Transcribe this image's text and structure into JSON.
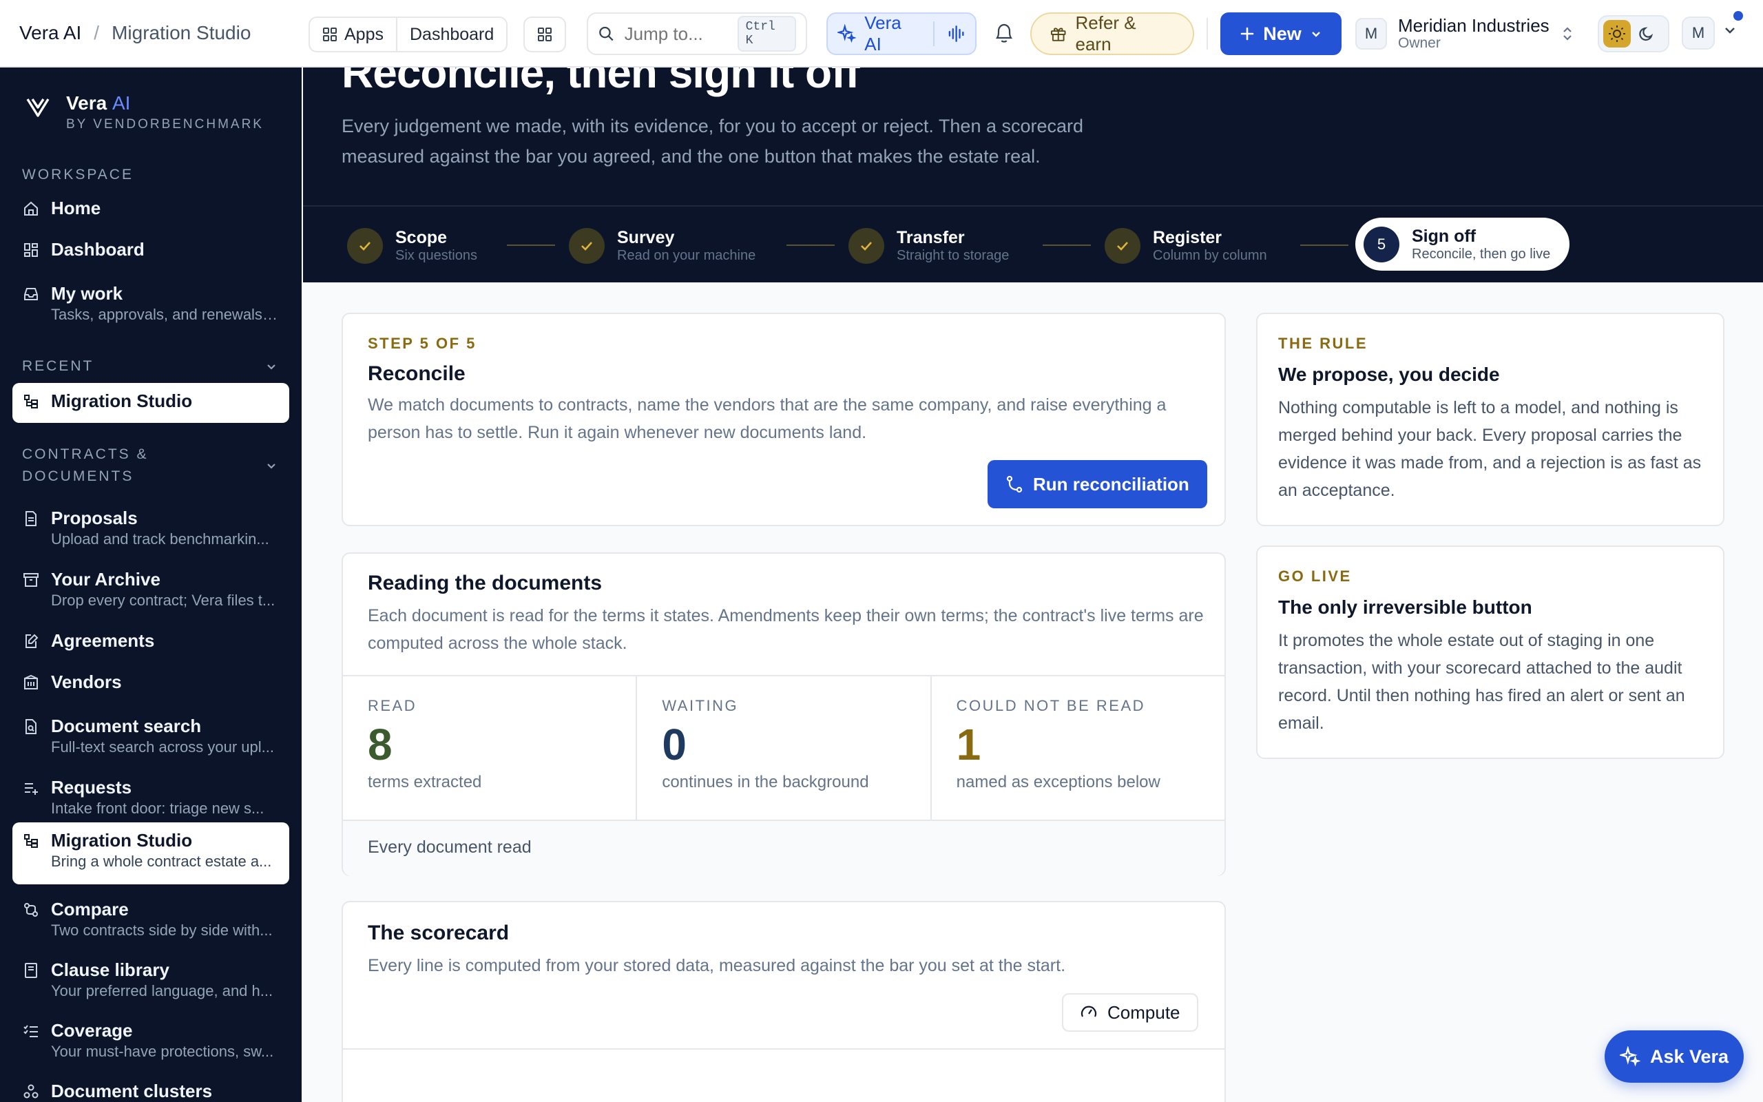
{
  "topbar": {
    "app_name": "Vera AI",
    "breadcrumb_current": "Migration Studio",
    "apps_label": "Apps",
    "dashboard_label": "Dashboard",
    "search_placeholder": "Jump to...",
    "search_shortcut": "Ctrl K",
    "vera_label": "Vera AI",
    "refer_label": "Refer & earn",
    "new_label": "New",
    "org_initial": "M",
    "org_name": "Meridian Industries",
    "org_role": "Owner",
    "user_initial": "M"
  },
  "sidebar": {
    "brand_name": "Vera",
    "brand_ai": "AI",
    "brand_sub": "BY VENDORBENCHMARK",
    "workspace_label": "WORKSPACE",
    "recent_label": "RECENT",
    "contracts_label_1": "CONTRACTS &",
    "contracts_label_2": "DOCUMENTS",
    "items": [
      {
        "title": "Home",
        "sub": ""
      },
      {
        "title": "Dashboard",
        "sub": ""
      },
      {
        "title": "My work",
        "sub": "Tasks, approvals, and renewals ..."
      },
      {
        "title": "Migration Studio",
        "sub": ""
      },
      {
        "title": "Proposals",
        "sub": "Upload and track benchmarkin..."
      },
      {
        "title": "Your Archive",
        "sub": "Drop every contract; Vera files t..."
      },
      {
        "title": "Agreements",
        "sub": ""
      },
      {
        "title": "Vendors",
        "sub": ""
      },
      {
        "title": "Document search",
        "sub": "Full-text search across your upl..."
      },
      {
        "title": "Requests",
        "sub": "Intake front door: triage new s..."
      },
      {
        "title": "Migration Studio",
        "sub": "Bring a whole contract estate a..."
      },
      {
        "title": "Compare",
        "sub": "Two contracts side by side with..."
      },
      {
        "title": "Clause library",
        "sub": "Your preferred language, and h..."
      },
      {
        "title": "Coverage",
        "sub": "Your must-have protections, sw..."
      },
      {
        "title": "Document clusters",
        "sub": ""
      }
    ]
  },
  "hero": {
    "title": "Reconcile, then sign it off",
    "description": "Every judgement we made, with its evidence, for you to accept or reject. Then a scorecard measured against the bar you agreed, and the one button that makes the estate real."
  },
  "steps": [
    {
      "title": "Scope",
      "sub": "Six questions",
      "status": "done"
    },
    {
      "title": "Survey",
      "sub": "Read on your machine",
      "status": "done"
    },
    {
      "title": "Transfer",
      "sub": "Straight to storage",
      "status": "done"
    },
    {
      "title": "Register",
      "sub": "Column by column",
      "status": "done"
    },
    {
      "number": "5",
      "title": "Sign off",
      "sub": "Reconcile, then go live",
      "status": "current"
    }
  ],
  "reconcile_card": {
    "eyebrow": "STEP 5 OF 5",
    "title": "Reconcile",
    "body": "We match documents to contracts, name the vendors that are the same company, and raise everything a person has to settle. Run it again whenever new documents land.",
    "button": "Run reconciliation"
  },
  "reading_card": {
    "title": "Reading the documents",
    "body": "Each document is read for the terms it states. Amendments keep their own terms; the contract's live terms are computed across the whole stack.",
    "stats": [
      {
        "label": "READ",
        "value": "8",
        "caption": "terms extracted",
        "color": "#3b5b2e"
      },
      {
        "label": "WAITING",
        "value": "0",
        "caption": "continues in the background",
        "color": "#1e3a5f"
      },
      {
        "label": "COULD NOT BE READ",
        "value": "1",
        "caption": "named as exceptions below",
        "color": "#8a6a10"
      }
    ],
    "footer": "Every document read"
  },
  "scorecard_card": {
    "title": "The scorecard",
    "body": "Every line is computed from your stored data, measured against the bar you set at the start.",
    "button": "Compute"
  },
  "rule_card": {
    "eyebrow": "THE RULE",
    "title": "We propose, you decide",
    "body": "Nothing computable is left to a model, and nothing is merged behind your back. Every proposal carries the evidence it was made from, and a rejection is as fast as an acceptance."
  },
  "golive_card": {
    "eyebrow": "GO LIVE",
    "title": "The only irreversible button",
    "body": "It promotes the whole estate out of staging in one transaction, with your scorecard attached to the audit record. Until then nothing has fired an alert or sent an email."
  },
  "ask_vera": "Ask Vera",
  "colors": {
    "accent": "#2453d6",
    "sidebar_bg": "#0b1428",
    "eyebrow": "#8a6a10"
  }
}
